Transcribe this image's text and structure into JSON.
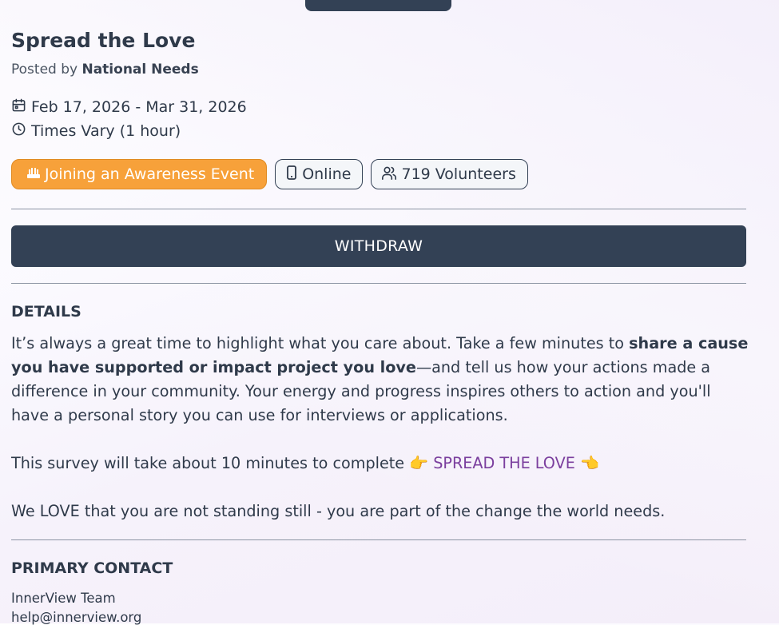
{
  "event": {
    "title": "Spread the Love",
    "posted_prefix": "Posted by",
    "organization": "National Needs",
    "date_range": "Feb 17, 2026 - Mar 31, 2026",
    "time": "Times Vary (1 hour)"
  },
  "tags": {
    "category": "Joining an Awareness Event",
    "location": "Online",
    "volunteers": "719 Volunteers"
  },
  "actions": {
    "withdraw_label": "WITHDRAW"
  },
  "details": {
    "heading": "DETAILS",
    "p1_start": "It’s always a great time to highlight what you care about. Take a few minutes to",
    "p1_bold": "share a cause you have supported or impact project you love",
    "p1_end": "—and tell us how your actions made a difference in your community. Your energy and progress inspires others to action and you'll have a personal story you can use for interviews or applications.",
    "p2_start": "This survey will take about 10 minutes to complete",
    "p2_link": "SPREAD THE LOVE",
    "p3": "We LOVE that you are not standing still - you are part of the change the world needs."
  },
  "contact": {
    "heading": "PRIMARY CONTACT",
    "name": "InnerView Team",
    "email": "help@innerview.org"
  },
  "icons": {
    "category": "raised-hands-icon",
    "location": "phone-icon",
    "volunteers": "users-icon",
    "date": "calendar-icon",
    "time": "clock-icon",
    "pointer_right": "pointing-right-emoji",
    "pointer_left": "pointing-left-emoji"
  },
  "colors": {
    "primary": "#334155",
    "accent_orange": "#f7a13a",
    "link_purple": "#7b3f9e"
  }
}
